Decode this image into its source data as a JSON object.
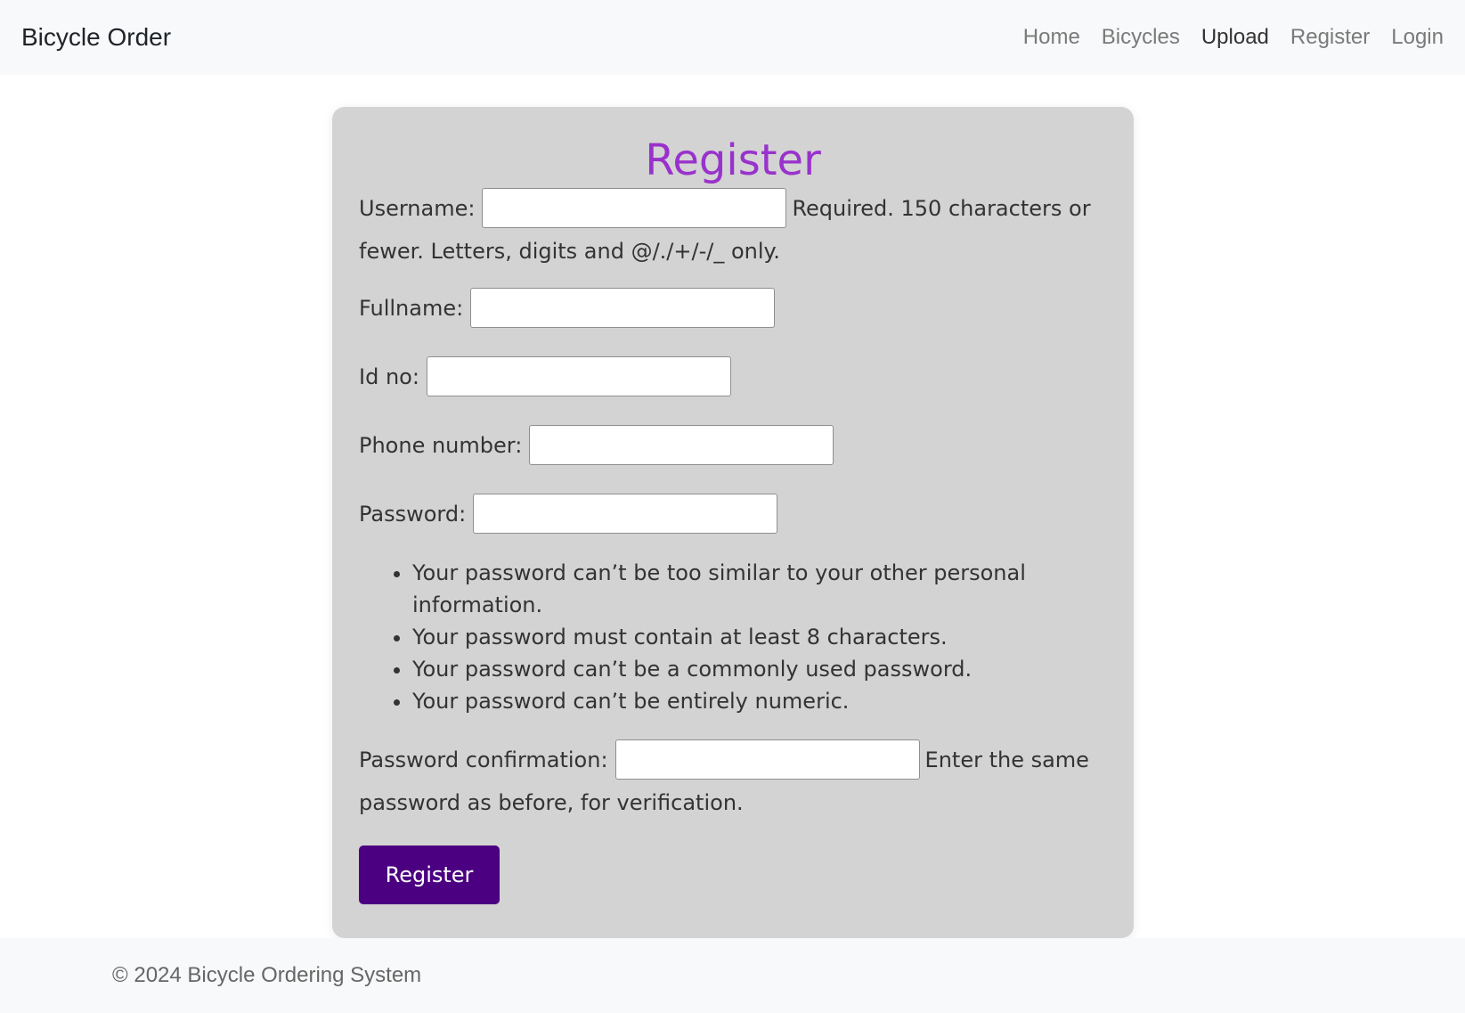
{
  "navbar": {
    "brand": "Bicycle Order",
    "links": [
      {
        "label": "Home",
        "active": false
      },
      {
        "label": "Bicycles",
        "active": false
      },
      {
        "label": "Upload",
        "active": true
      },
      {
        "label": "Register",
        "active": false
      },
      {
        "label": "Login",
        "active": false
      }
    ]
  },
  "form": {
    "title": "Register",
    "username": {
      "label": "Username:",
      "value": "",
      "help": "Required. 150 characters or fewer. Letters, digits and @/./+/-/_ only."
    },
    "fullname": {
      "label": "Fullname:",
      "value": ""
    },
    "id_no": {
      "label": "Id no:",
      "value": ""
    },
    "phone": {
      "label": "Phone number:",
      "value": ""
    },
    "password": {
      "label": "Password:",
      "value": ""
    },
    "password_rules": [
      "Your password can’t be too similar to your other personal information.",
      "Your password must contain at least 8 characters.",
      "Your password can’t be a commonly used password.",
      "Your password can’t be entirely numeric."
    ],
    "password_confirm": {
      "label": "Password confirmation:",
      "value": "",
      "help": "Enter the same password as before, for verification."
    },
    "submit_label": "Register"
  },
  "footer": {
    "text": "© 2024 Bicycle Ordering System"
  },
  "colors": {
    "title": "#9932cc",
    "button": "#4b0082",
    "card": "#d3d3d3",
    "navbar": "#f8f9fa"
  }
}
